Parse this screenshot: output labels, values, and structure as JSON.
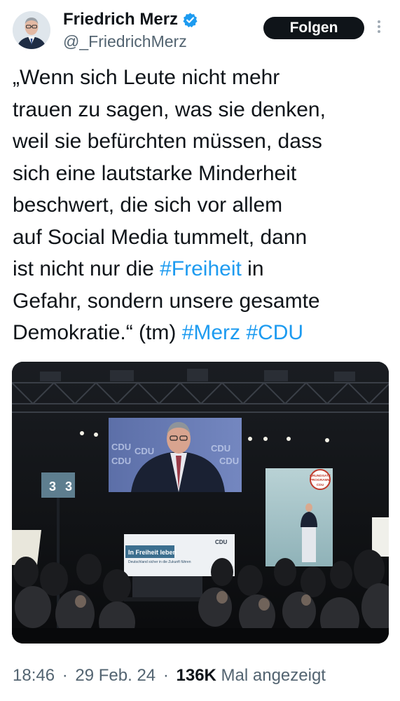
{
  "author": {
    "display_name": "Friedrich Merz",
    "handle": "@_FriedrichMerz",
    "verified_icon": "verified-badge-icon",
    "follow_label": "Folgen"
  },
  "tweet": {
    "lines": [
      [
        {
          "t": "„Wenn sich Leute nicht mehr"
        }
      ],
      [
        {
          "t": "trauen zu sagen, was sie denken,"
        }
      ],
      [
        {
          "t": "weil sie befürchten müssen, dass"
        }
      ],
      [
        {
          "t": "sich eine lautstarke Minderheit"
        }
      ],
      [
        {
          "t": "beschwert, die sich vor allem"
        }
      ],
      [
        {
          "t": "auf Social Media tummelt, dann"
        }
      ],
      [
        {
          "t": "ist nicht nur die "
        },
        {
          "t": "#Freiheit",
          "tag": true
        },
        {
          "t": " in"
        }
      ],
      [
        {
          "t": "Gefahr, sondern unsere gesamte"
        }
      ],
      [
        {
          "t": "Demokratie.“ (tm) "
        },
        {
          "t": "#Merz",
          "tag": true
        },
        {
          "t": " "
        },
        {
          "t": "#CDU",
          "tag": true
        }
      ]
    ]
  },
  "media": {
    "screen_text": [
      "CDU",
      "CDU",
      "CDU",
      "CDU",
      "CDU"
    ],
    "podium_title": "In Freiheit leben",
    "podium_subtitle": "Deutschland sicher in die Zukunft führen",
    "podium_logo": "CDU",
    "stage_number": "3",
    "stage_number_2": "3",
    "badge_lines": [
      "GRUNDSATZ",
      "PROGRAMM",
      "CDU"
    ]
  },
  "footer": {
    "time": "18:46",
    "dot1": "·",
    "date": "29 Feb. 24",
    "dot2": "·",
    "views": "136K",
    "views_label": "Mal angezeigt"
  },
  "colors": {
    "link": "#1d9bf0",
    "text": "#0f1419",
    "secondary": "#536471",
    "button": "#0f1419"
  }
}
